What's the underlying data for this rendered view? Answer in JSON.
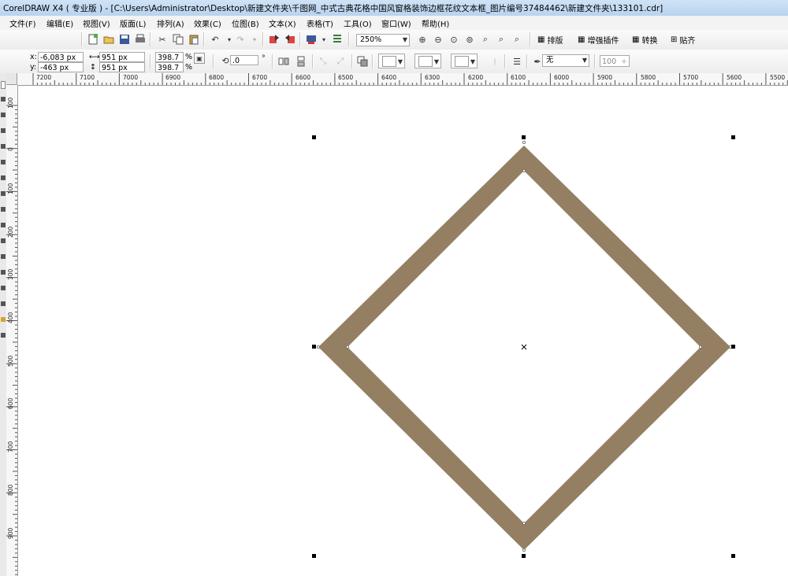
{
  "window": {
    "title": "CorelDRAW X4 ( 专业版 ) - [C:\\Users\\Administrator\\Desktop\\新建文件夹\\千图网_中式古典花格中国风窗格装饰边框花纹文本框_图片编号37484462\\新建文件夹\\133101.cdr]"
  },
  "menu": [
    "文件(F)",
    "编辑(E)",
    "视图(V)",
    "版面(L)",
    "排列(A)",
    "效果(C)",
    "位图(B)",
    "文本(X)",
    "表格(T)",
    "工具(O)",
    "窗口(W)",
    "帮助(H)"
  ],
  "toolbar": {
    "zoom": "250%",
    "plugins": [
      "排版",
      "增强插件",
      "转换",
      "贴齐"
    ]
  },
  "property_bar": {
    "x_label": "x:",
    "x_value": "-6,083 px",
    "y_label": "y:",
    "y_value": "-463 px",
    "width": "951 px",
    "height": "951 px",
    "scale_w": "398.7",
    "scale_h": "398.7",
    "percent": "%",
    "rotation": ".0",
    "degree": "°",
    "outline": "无",
    "opacity": "100"
  },
  "ruler": {
    "h_ticks": [
      "7200",
      "7100",
      "7000",
      "6900",
      "6800",
      "6700",
      "6600",
      "6500",
      "6400",
      "6300",
      "6200",
      "6100",
      "6000",
      "5900",
      "5800",
      "5700",
      "5600",
      "5500"
    ],
    "v_ticks": [
      "100",
      "0",
      "100",
      "200",
      "300",
      "400",
      "500",
      "600",
      "700",
      "800",
      "900"
    ]
  },
  "shape": {
    "fill_color": "#947f63",
    "type": "diamond-frame"
  }
}
